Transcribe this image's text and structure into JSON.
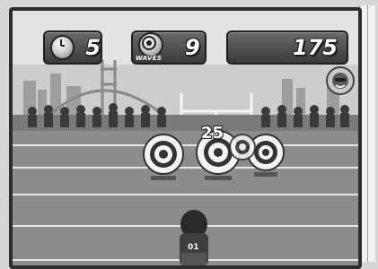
{
  "hud": {
    "timer_value": "5",
    "timer_icon": "stopwatch-icon",
    "waves_label": "WAVES",
    "waves_value": "9",
    "waves_icon": "target-icon",
    "score_value": "175"
  },
  "field": {
    "floating_points": "25",
    "player_number": "01"
  },
  "colors": {
    "hud_panel": "#4a4a4a",
    "grass": "#8c8c8c",
    "sky": "#cfcfcf"
  }
}
